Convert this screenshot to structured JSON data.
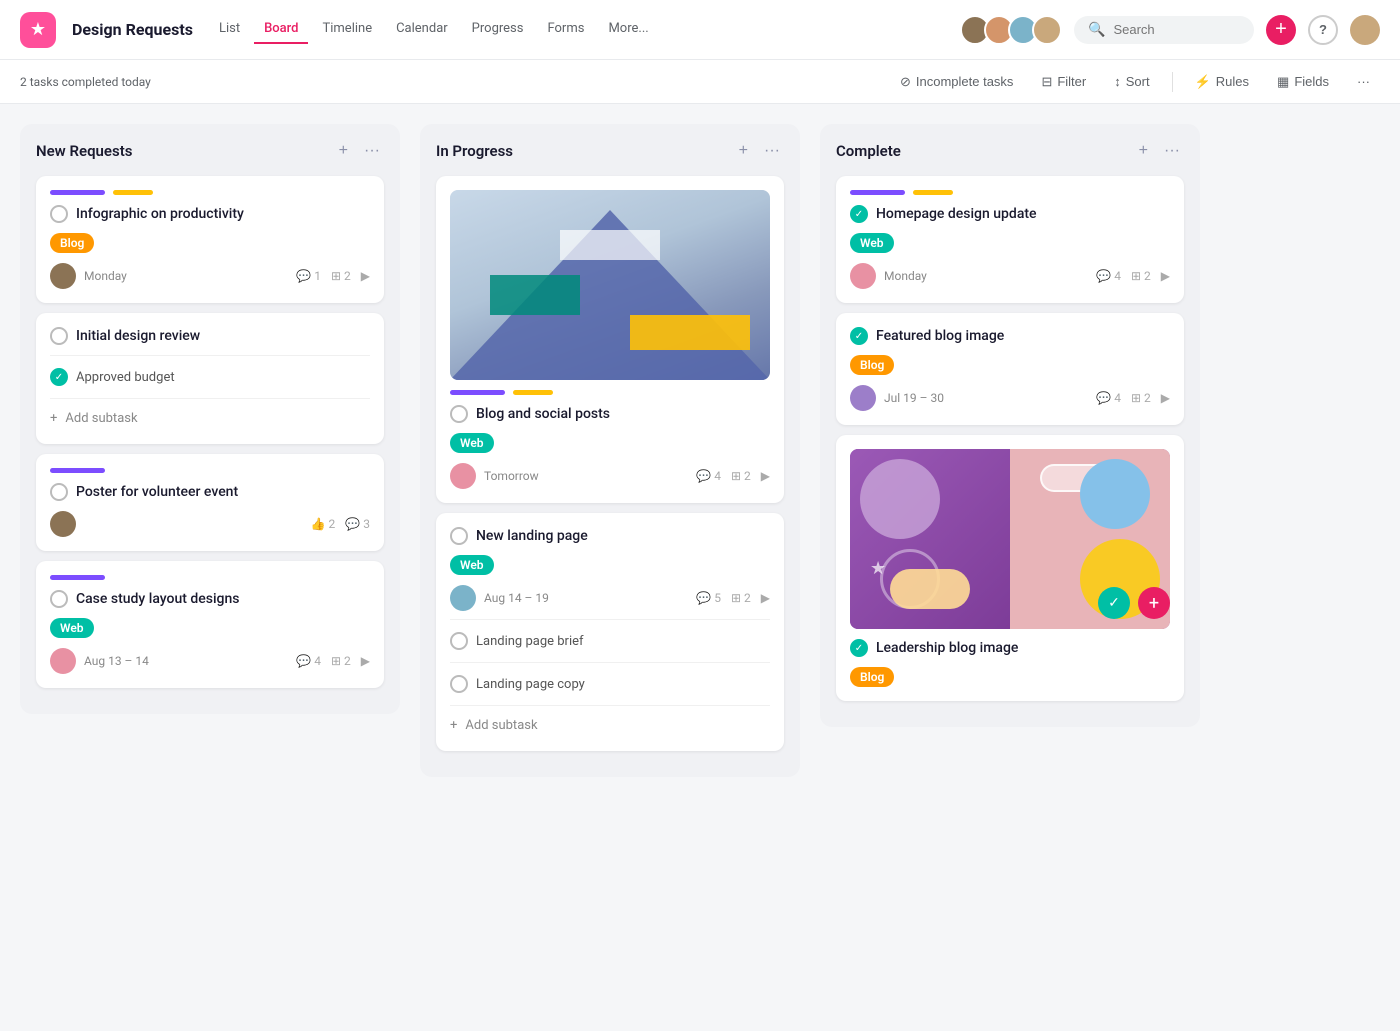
{
  "app": {
    "logo_icon": "★",
    "title": "Design Requests",
    "nav": [
      {
        "label": "List",
        "active": false
      },
      {
        "label": "Board",
        "active": true
      },
      {
        "label": "Timeline",
        "active": false
      },
      {
        "label": "Calendar",
        "active": false
      },
      {
        "label": "Progress",
        "active": false
      },
      {
        "label": "Forms",
        "active": false
      },
      {
        "label": "More...",
        "active": false
      }
    ]
  },
  "toolbar": {
    "tasks_completed": "2 tasks completed today",
    "incomplete_tasks": "Incomplete tasks",
    "filter": "Filter",
    "sort": "Sort",
    "rules": "Rules",
    "fields": "Fields"
  },
  "columns": [
    {
      "id": "new-requests",
      "title": "New Requests",
      "cards": [
        {
          "id": "card-1",
          "title": "Infographic on productivity",
          "badge": "Blog",
          "badge_type": "orange",
          "avatar_color": "dark",
          "date": "Monday",
          "comments": "1",
          "subtasks_count": "2",
          "has_arrow": true,
          "tags": [
            "purple",
            "yellow"
          ]
        },
        {
          "id": "card-2",
          "title": "Initial design review",
          "subtasks": [
            "Approved budget"
          ],
          "add_subtask": "Add subtask",
          "tags": []
        },
        {
          "id": "card-3",
          "title": "Poster for volunteer event",
          "avatar_color": "dark",
          "likes": "2",
          "comments": "3",
          "tags": [
            "purple"
          ]
        },
        {
          "id": "card-4",
          "title": "Case study layout designs",
          "badge": "Web",
          "badge_type": "teal",
          "avatar_color": "pink",
          "date": "Aug 13 – 14",
          "comments": "4",
          "subtasks_count": "2",
          "has_arrow": true,
          "tags": [
            "purple"
          ]
        }
      ]
    },
    {
      "id": "in-progress",
      "title": "In Progress",
      "cards": [
        {
          "id": "card-5",
          "title": "Blog and social posts",
          "badge": "Web",
          "badge_type": "teal",
          "has_image": true,
          "avatar_color": "pink",
          "date": "Tomorrow",
          "comments": "4",
          "subtasks_count": "2",
          "has_arrow": true,
          "tags": [
            "purple",
            "yellow"
          ]
        },
        {
          "id": "card-6",
          "title": "New landing page",
          "badge": "Web",
          "badge_type": "teal",
          "avatar_color": "blue",
          "date": "Aug 14 – 19",
          "comments": "5",
          "subtasks_count": "2",
          "has_arrow": true,
          "subtasks": [
            "Landing page brief",
            "Landing page copy"
          ],
          "add_subtask": "Add subtask",
          "tags": []
        }
      ]
    },
    {
      "id": "complete",
      "title": "Complete",
      "cards": [
        {
          "id": "card-7",
          "title": "Homepage design update",
          "badge": "Web",
          "badge_type": "teal",
          "done": true,
          "avatar_color": "pink",
          "date": "Monday",
          "comments": "4",
          "subtasks_count": "2",
          "has_arrow": true,
          "tags": [
            "purple",
            "yellow"
          ]
        },
        {
          "id": "card-8",
          "title": "Featured blog image",
          "badge": "Blog",
          "badge_type": "orange",
          "done": true,
          "avatar_color": "purple",
          "date": "Jul 19 – 30",
          "comments": "4",
          "subtasks_count": "2",
          "has_arrow": true,
          "tags": []
        },
        {
          "id": "card-9",
          "title": "Leadership blog image",
          "badge": "Blog",
          "badge_type": "orange",
          "done": true,
          "has_abstract_image": true,
          "tags": []
        }
      ]
    }
  ]
}
